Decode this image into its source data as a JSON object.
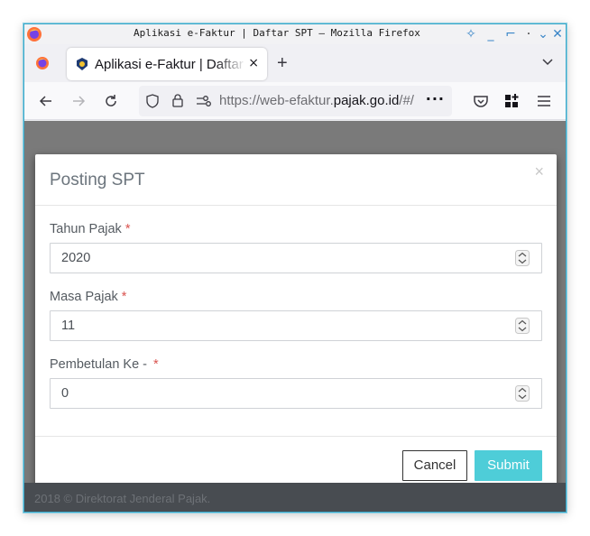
{
  "window": {
    "title": "Aplikasi e-Faktur | Daftar SPT — Mozilla Firefox"
  },
  "tabs": [
    {
      "title": "Aplikasi e-Faktur | Daftar SPT",
      "close": "×"
    }
  ],
  "newtab": "+",
  "urlbar": {
    "prefix": "https://web-efaktur.",
    "domain": "pajak.go.id",
    "suffix": "/#/",
    "more": "···"
  },
  "modal": {
    "title": "Posting SPT",
    "close": "×",
    "fields": [
      {
        "label": "Tahun Pajak",
        "required_mark": "*",
        "value": "2020"
      },
      {
        "label": "Masa Pajak",
        "required_mark": "*",
        "value": "11"
      },
      {
        "label": "Pembetulan Ke -",
        "required_mark": "*",
        "value": "0"
      }
    ],
    "buttons": {
      "cancel": "Cancel",
      "submit": "Submit"
    }
  },
  "footer": {
    "text": "2018 © Direktorat Jenderal Pajak."
  },
  "colors": {
    "submit": "#4ecdd8",
    "required": "#d9534f",
    "window_border": "#39a7c8"
  }
}
